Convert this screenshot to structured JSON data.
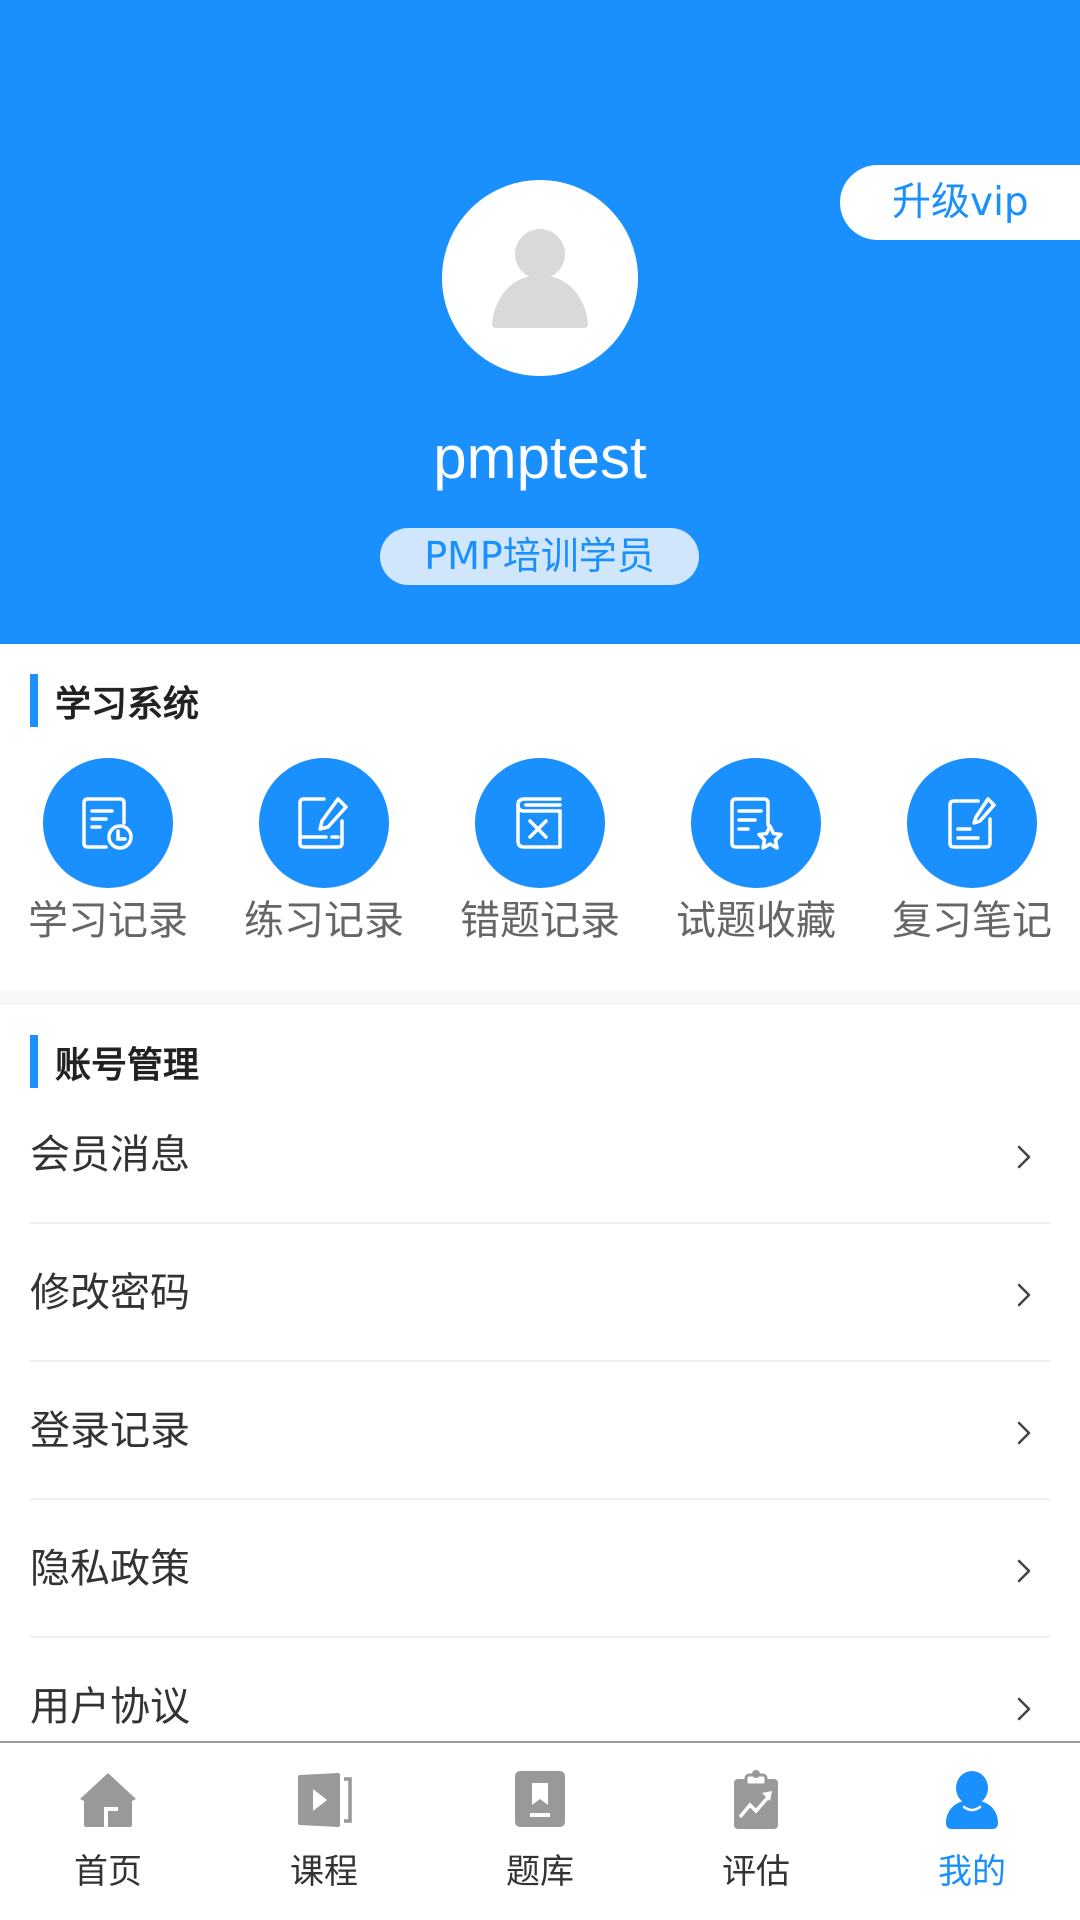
{
  "header": {
    "vip_button": "升级vip",
    "username": "pmptest",
    "role": "PMP培训学员",
    "avatar_icon": "default-user-icon"
  },
  "study_section": {
    "title": "学习系统",
    "items": [
      {
        "label": "学习记录",
        "icon": "study-record-icon"
      },
      {
        "label": "练习记录",
        "icon": "practice-record-icon"
      },
      {
        "label": "错题记录",
        "icon": "wrong-question-icon"
      },
      {
        "label": "试题收藏",
        "icon": "favorite-question-icon"
      },
      {
        "label": "复习笔记",
        "icon": "review-note-icon"
      }
    ]
  },
  "account_section": {
    "title": "账号管理",
    "items": [
      {
        "label": "会员消息"
      },
      {
        "label": "修改密码"
      },
      {
        "label": "登录记录"
      },
      {
        "label": "隐私政策"
      },
      {
        "label": "用户协议"
      }
    ]
  },
  "tabbar": {
    "active_index": 4,
    "items": [
      {
        "label": "首页",
        "icon": "home-icon"
      },
      {
        "label": "课程",
        "icon": "course-icon"
      },
      {
        "label": "题库",
        "icon": "question-bank-icon"
      },
      {
        "label": "评估",
        "icon": "assessment-icon"
      },
      {
        "label": "我的",
        "icon": "profile-icon"
      }
    ]
  },
  "colors": {
    "primary": "#1a90fe",
    "pill_bg": "#cfe6fd",
    "inactive_icon": "#999999",
    "text": "#333333",
    "sub_text": "#666666"
  }
}
